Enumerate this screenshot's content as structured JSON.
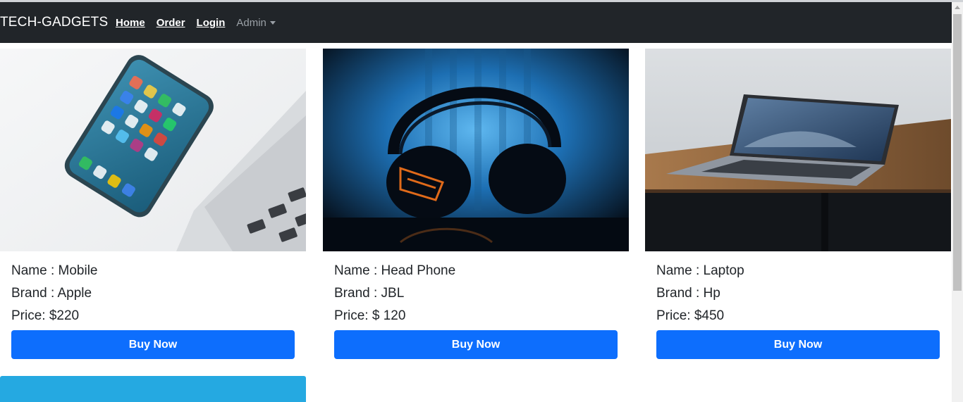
{
  "navbar": {
    "brand": "TECH-GADGETS",
    "links": [
      "Home",
      "Order",
      "Login"
    ],
    "dropdown_label": "Admin"
  },
  "products": [
    {
      "name_line": "Name : Mobile",
      "brand_line": "Brand : Apple",
      "price_line": "Price: $220",
      "button": "Buy Now",
      "image": "phone-on-laptop-photo"
    },
    {
      "name_line": "Name : Head Phone",
      "brand_line": "Brand : JBL",
      "price_line": "Price: $ 120",
      "button": "Buy Now",
      "image": "headphones-blue-photo"
    },
    {
      "name_line": "Name : Laptop",
      "brand_line": "Brand : Hp",
      "price_line": "Price: $450",
      "button": "Buy Now",
      "image": "laptop-on-desk-photo"
    }
  ],
  "colors": {
    "navbar_bg": "#212529",
    "button_bg": "#0d6efd",
    "partial_card": "#25a9e1"
  }
}
